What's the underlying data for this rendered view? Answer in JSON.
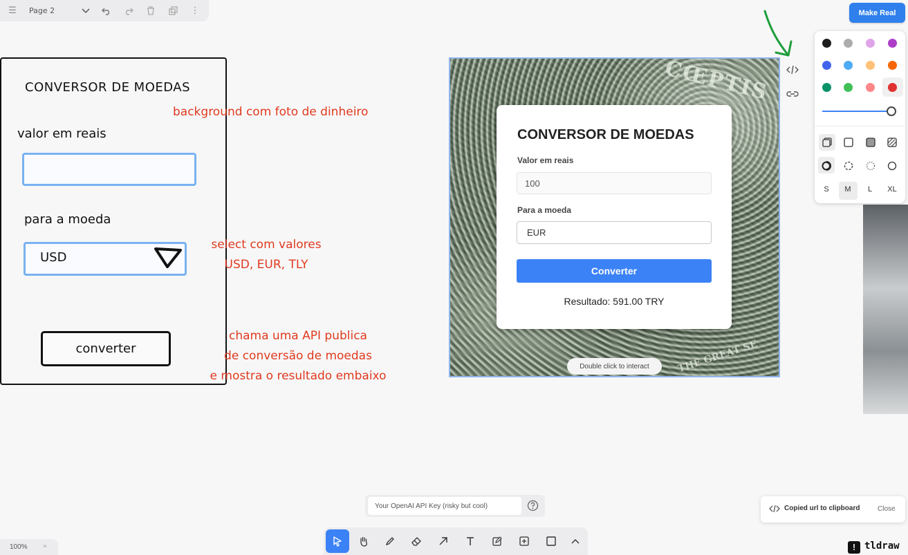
{
  "topbar": {
    "page_name": "Page 2",
    "icons": [
      "menu-icon",
      "chevron-down-icon",
      "undo-icon",
      "redo-icon",
      "trash-icon",
      "duplicate-icon",
      "more-icon"
    ]
  },
  "make_real": {
    "label": "Make Real",
    "color": "#2f80ed"
  },
  "wireframe": {
    "title": "CONVERSOR DE MOEDAS",
    "label_value": "valor em reais",
    "label_currency": "para a moeda",
    "select_value": "USD",
    "button": "converter"
  },
  "annotations": {
    "background": "background com foto de dinheiro",
    "select_line1": "select com valores",
    "select_line2": "USD, EUR, TLY",
    "api_line1": "chama uma API publica",
    "api_line2": "de conversão de moedas",
    "api_line3": "e mostra o resultado embaixo",
    "color": "#e03a1e"
  },
  "preview": {
    "bill_text_1": "CŒPTIS",
    "bill_text_2": "THE GREAT SE",
    "card": {
      "title": "CONVERSOR DE MOEDAS",
      "label_value": "Valor em reais",
      "input_value": "100",
      "label_currency": "Para a moeda",
      "select_value": "EUR",
      "button": "Converter",
      "result": "Resultado: 591.00 TRY",
      "accent": "#3b82f6"
    },
    "interact_hint": "Double click to interact"
  },
  "style_panel": {
    "colors": [
      "#1d1d1d",
      "#adadad",
      "#e0a4ea",
      "#ae3ec9",
      "#4263eb",
      "#4dabf7",
      "#ffc078",
      "#f76707",
      "#099268",
      "#40c057",
      "#ff8787",
      "#e03131"
    ],
    "opacity": 1.0,
    "sizes": [
      "S",
      "M",
      "L",
      "XL"
    ],
    "selected_size": "M"
  },
  "bottom": {
    "api_key_placeholder": "Your OpenAI API Key (risky but cool)",
    "zoom": "100%",
    "zoom_more": "»",
    "toast_text": "Copied url to clipboard",
    "toast_close": "Close",
    "brand": "tldraw",
    "brand_logo": "!"
  },
  "tools": [
    "select-tool-icon",
    "hand-tool-icon",
    "draw-tool-icon",
    "eraser-tool-icon",
    "arrow-tool-icon",
    "text-tool-icon",
    "note-tool-icon",
    "image-tool-icon",
    "rectangle-tool-icon",
    "chevron-up-icon"
  ]
}
